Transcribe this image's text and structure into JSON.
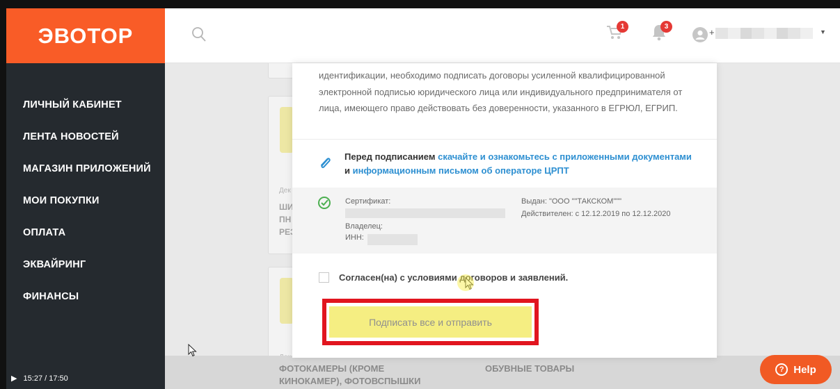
{
  "brand": {
    "logo": "ЭВОТОР"
  },
  "nav": [
    "ЛИЧНЫЙ КАБИНЕТ",
    "ЛЕНТА НОВОСТЕЙ",
    "МАГАЗИН ПРИЛОЖЕНИЙ",
    "МОИ ПОКУПКИ",
    "ОПЛАТА",
    "ЭКВАЙРИНГ",
    "ФИНАНСЫ"
  ],
  "header": {
    "cart_count": "1",
    "notifications_count": "3",
    "user_initial": "+"
  },
  "modal": {
    "intro_text": "идентификации, необходимо подписать договоры усиленной квалифицированной электронной подписью юридического лица или индивидуального предпринимателя от лица, имеющего право действовать без доверенности, указанного в ЕГРЮЛ, ЕГРИП.",
    "notice_prefix": "Перед подписанием",
    "notice_link1": "скачайте и ознакомьтесь с приложенными документами",
    "notice_and": "и",
    "notice_link2": "информационным письмом об операторе ЦРПТ",
    "cert": {
      "certificate_label": "Сертификат:",
      "owner_label": "Владелец:",
      "inn_label": "ИНН:",
      "issuer": "Выдан: \"ООО \"\"ТАКСКОМ\"\"\"",
      "validity": "Действителен: с 12.12.2019 по 12.12.2020"
    },
    "agree_label": "Согласен(на) с условиями договоров и заявлений.",
    "sign_button": "Подписать все и отправить"
  },
  "background": {
    "small_label_1": "Дек",
    "small_label_2": "Дек",
    "card_text": [
      "ШИ",
      "ПН",
      "РЕЗ"
    ],
    "bottom_left": "ФОТОКАМЕРЫ (КРОМЕ\nКИНОКАМЕР), ФОТОВСПЫШКИ",
    "bottom_right": "ОБУВНЫЕ ТОВАРЫ"
  },
  "help": {
    "label": "Help"
  },
  "video": {
    "time": "15:27 / 17:50"
  },
  "colors": {
    "brand_orange": "#f95c27",
    "sidebar": "#252a2f",
    "link": "#2d8fd1",
    "highlight": "#e1151f",
    "button": "#f5ee82"
  }
}
